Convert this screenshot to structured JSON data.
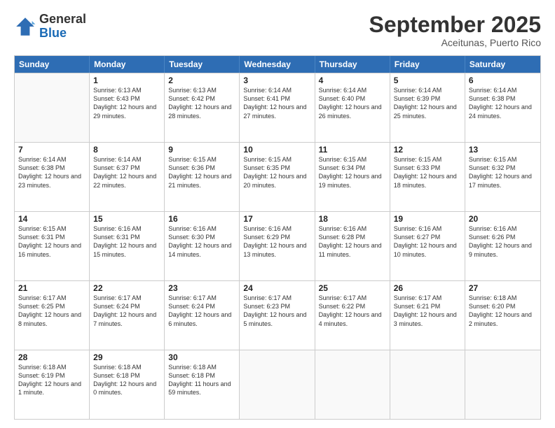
{
  "logo": {
    "general": "General",
    "blue": "Blue"
  },
  "header": {
    "month": "September 2025",
    "location": "Aceitunas, Puerto Rico"
  },
  "days_of_week": [
    "Sunday",
    "Monday",
    "Tuesday",
    "Wednesday",
    "Thursday",
    "Friday",
    "Saturday"
  ],
  "weeks": [
    [
      {
        "day": "",
        "empty": true
      },
      {
        "day": "1",
        "sunrise": "Sunrise: 6:13 AM",
        "sunset": "Sunset: 6:43 PM",
        "daylight": "Daylight: 12 hours and 29 minutes."
      },
      {
        "day": "2",
        "sunrise": "Sunrise: 6:13 AM",
        "sunset": "Sunset: 6:42 PM",
        "daylight": "Daylight: 12 hours and 28 minutes."
      },
      {
        "day": "3",
        "sunrise": "Sunrise: 6:14 AM",
        "sunset": "Sunset: 6:41 PM",
        "daylight": "Daylight: 12 hours and 27 minutes."
      },
      {
        "day": "4",
        "sunrise": "Sunrise: 6:14 AM",
        "sunset": "Sunset: 6:40 PM",
        "daylight": "Daylight: 12 hours and 26 minutes."
      },
      {
        "day": "5",
        "sunrise": "Sunrise: 6:14 AM",
        "sunset": "Sunset: 6:39 PM",
        "daylight": "Daylight: 12 hours and 25 minutes."
      },
      {
        "day": "6",
        "sunrise": "Sunrise: 6:14 AM",
        "sunset": "Sunset: 6:38 PM",
        "daylight": "Daylight: 12 hours and 24 minutes."
      }
    ],
    [
      {
        "day": "7",
        "sunrise": "Sunrise: 6:14 AM",
        "sunset": "Sunset: 6:38 PM",
        "daylight": "Daylight: 12 hours and 23 minutes."
      },
      {
        "day": "8",
        "sunrise": "Sunrise: 6:14 AM",
        "sunset": "Sunset: 6:37 PM",
        "daylight": "Daylight: 12 hours and 22 minutes."
      },
      {
        "day": "9",
        "sunrise": "Sunrise: 6:15 AM",
        "sunset": "Sunset: 6:36 PM",
        "daylight": "Daylight: 12 hours and 21 minutes."
      },
      {
        "day": "10",
        "sunrise": "Sunrise: 6:15 AM",
        "sunset": "Sunset: 6:35 PM",
        "daylight": "Daylight: 12 hours and 20 minutes."
      },
      {
        "day": "11",
        "sunrise": "Sunrise: 6:15 AM",
        "sunset": "Sunset: 6:34 PM",
        "daylight": "Daylight: 12 hours and 19 minutes."
      },
      {
        "day": "12",
        "sunrise": "Sunrise: 6:15 AM",
        "sunset": "Sunset: 6:33 PM",
        "daylight": "Daylight: 12 hours and 18 minutes."
      },
      {
        "day": "13",
        "sunrise": "Sunrise: 6:15 AM",
        "sunset": "Sunset: 6:32 PM",
        "daylight": "Daylight: 12 hours and 17 minutes."
      }
    ],
    [
      {
        "day": "14",
        "sunrise": "Sunrise: 6:15 AM",
        "sunset": "Sunset: 6:31 PM",
        "daylight": "Daylight: 12 hours and 16 minutes."
      },
      {
        "day": "15",
        "sunrise": "Sunrise: 6:16 AM",
        "sunset": "Sunset: 6:31 PM",
        "daylight": "Daylight: 12 hours and 15 minutes."
      },
      {
        "day": "16",
        "sunrise": "Sunrise: 6:16 AM",
        "sunset": "Sunset: 6:30 PM",
        "daylight": "Daylight: 12 hours and 14 minutes."
      },
      {
        "day": "17",
        "sunrise": "Sunrise: 6:16 AM",
        "sunset": "Sunset: 6:29 PM",
        "daylight": "Daylight: 12 hours and 13 minutes."
      },
      {
        "day": "18",
        "sunrise": "Sunrise: 6:16 AM",
        "sunset": "Sunset: 6:28 PM",
        "daylight": "Daylight: 12 hours and 11 minutes."
      },
      {
        "day": "19",
        "sunrise": "Sunrise: 6:16 AM",
        "sunset": "Sunset: 6:27 PM",
        "daylight": "Daylight: 12 hours and 10 minutes."
      },
      {
        "day": "20",
        "sunrise": "Sunrise: 6:16 AM",
        "sunset": "Sunset: 6:26 PM",
        "daylight": "Daylight: 12 hours and 9 minutes."
      }
    ],
    [
      {
        "day": "21",
        "sunrise": "Sunrise: 6:17 AM",
        "sunset": "Sunset: 6:25 PM",
        "daylight": "Daylight: 12 hours and 8 minutes."
      },
      {
        "day": "22",
        "sunrise": "Sunrise: 6:17 AM",
        "sunset": "Sunset: 6:24 PM",
        "daylight": "Daylight: 12 hours and 7 minutes."
      },
      {
        "day": "23",
        "sunrise": "Sunrise: 6:17 AM",
        "sunset": "Sunset: 6:24 PM",
        "daylight": "Daylight: 12 hours and 6 minutes."
      },
      {
        "day": "24",
        "sunrise": "Sunrise: 6:17 AM",
        "sunset": "Sunset: 6:23 PM",
        "daylight": "Daylight: 12 hours and 5 minutes."
      },
      {
        "day": "25",
        "sunrise": "Sunrise: 6:17 AM",
        "sunset": "Sunset: 6:22 PM",
        "daylight": "Daylight: 12 hours and 4 minutes."
      },
      {
        "day": "26",
        "sunrise": "Sunrise: 6:17 AM",
        "sunset": "Sunset: 6:21 PM",
        "daylight": "Daylight: 12 hours and 3 minutes."
      },
      {
        "day": "27",
        "sunrise": "Sunrise: 6:18 AM",
        "sunset": "Sunset: 6:20 PM",
        "daylight": "Daylight: 12 hours and 2 minutes."
      }
    ],
    [
      {
        "day": "28",
        "sunrise": "Sunrise: 6:18 AM",
        "sunset": "Sunset: 6:19 PM",
        "daylight": "Daylight: 12 hours and 1 minute."
      },
      {
        "day": "29",
        "sunrise": "Sunrise: 6:18 AM",
        "sunset": "Sunset: 6:18 PM",
        "daylight": "Daylight: 12 hours and 0 minutes."
      },
      {
        "day": "30",
        "sunrise": "Sunrise: 6:18 AM",
        "sunset": "Sunset: 6:18 PM",
        "daylight": "Daylight: 11 hours and 59 minutes."
      },
      {
        "day": "",
        "empty": true
      },
      {
        "day": "",
        "empty": true
      },
      {
        "day": "",
        "empty": true
      },
      {
        "day": "",
        "empty": true
      }
    ]
  ]
}
